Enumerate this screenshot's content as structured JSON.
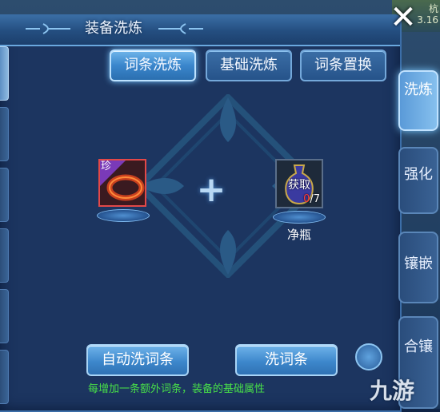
{
  "window": {
    "title": "装备洗炼",
    "close_label": "✕"
  },
  "background": {
    "corner_text_1": "杭",
    "corner_text_2": "3.16"
  },
  "top_tabs": [
    {
      "label": "词条洗炼",
      "active": true
    },
    {
      "label": "基础洗炼",
      "active": false
    },
    {
      "label": "词条置换",
      "active": false
    }
  ],
  "side_tabs": [
    {
      "label": "洗炼",
      "active": true
    },
    {
      "label": "强化",
      "active": false
    },
    {
      "label": "镶嵌",
      "active": false
    },
    {
      "label": "合镶",
      "active": false
    }
  ],
  "equipment": {
    "rarity_tag": "珍",
    "border_color": "#e24848"
  },
  "material": {
    "acquire_label": "获取",
    "have_count": "0",
    "need_count": "/7",
    "name": "净瓶"
  },
  "actions": {
    "auto_label": "自动洗词条",
    "wash_label": "洗词条"
  },
  "hint": "每增加一条额外词条，装备的基础属性",
  "watermark": "九游",
  "colors": {
    "accent": "#3a86cc",
    "hint": "#48e048",
    "warning": "#ff3a3a"
  }
}
